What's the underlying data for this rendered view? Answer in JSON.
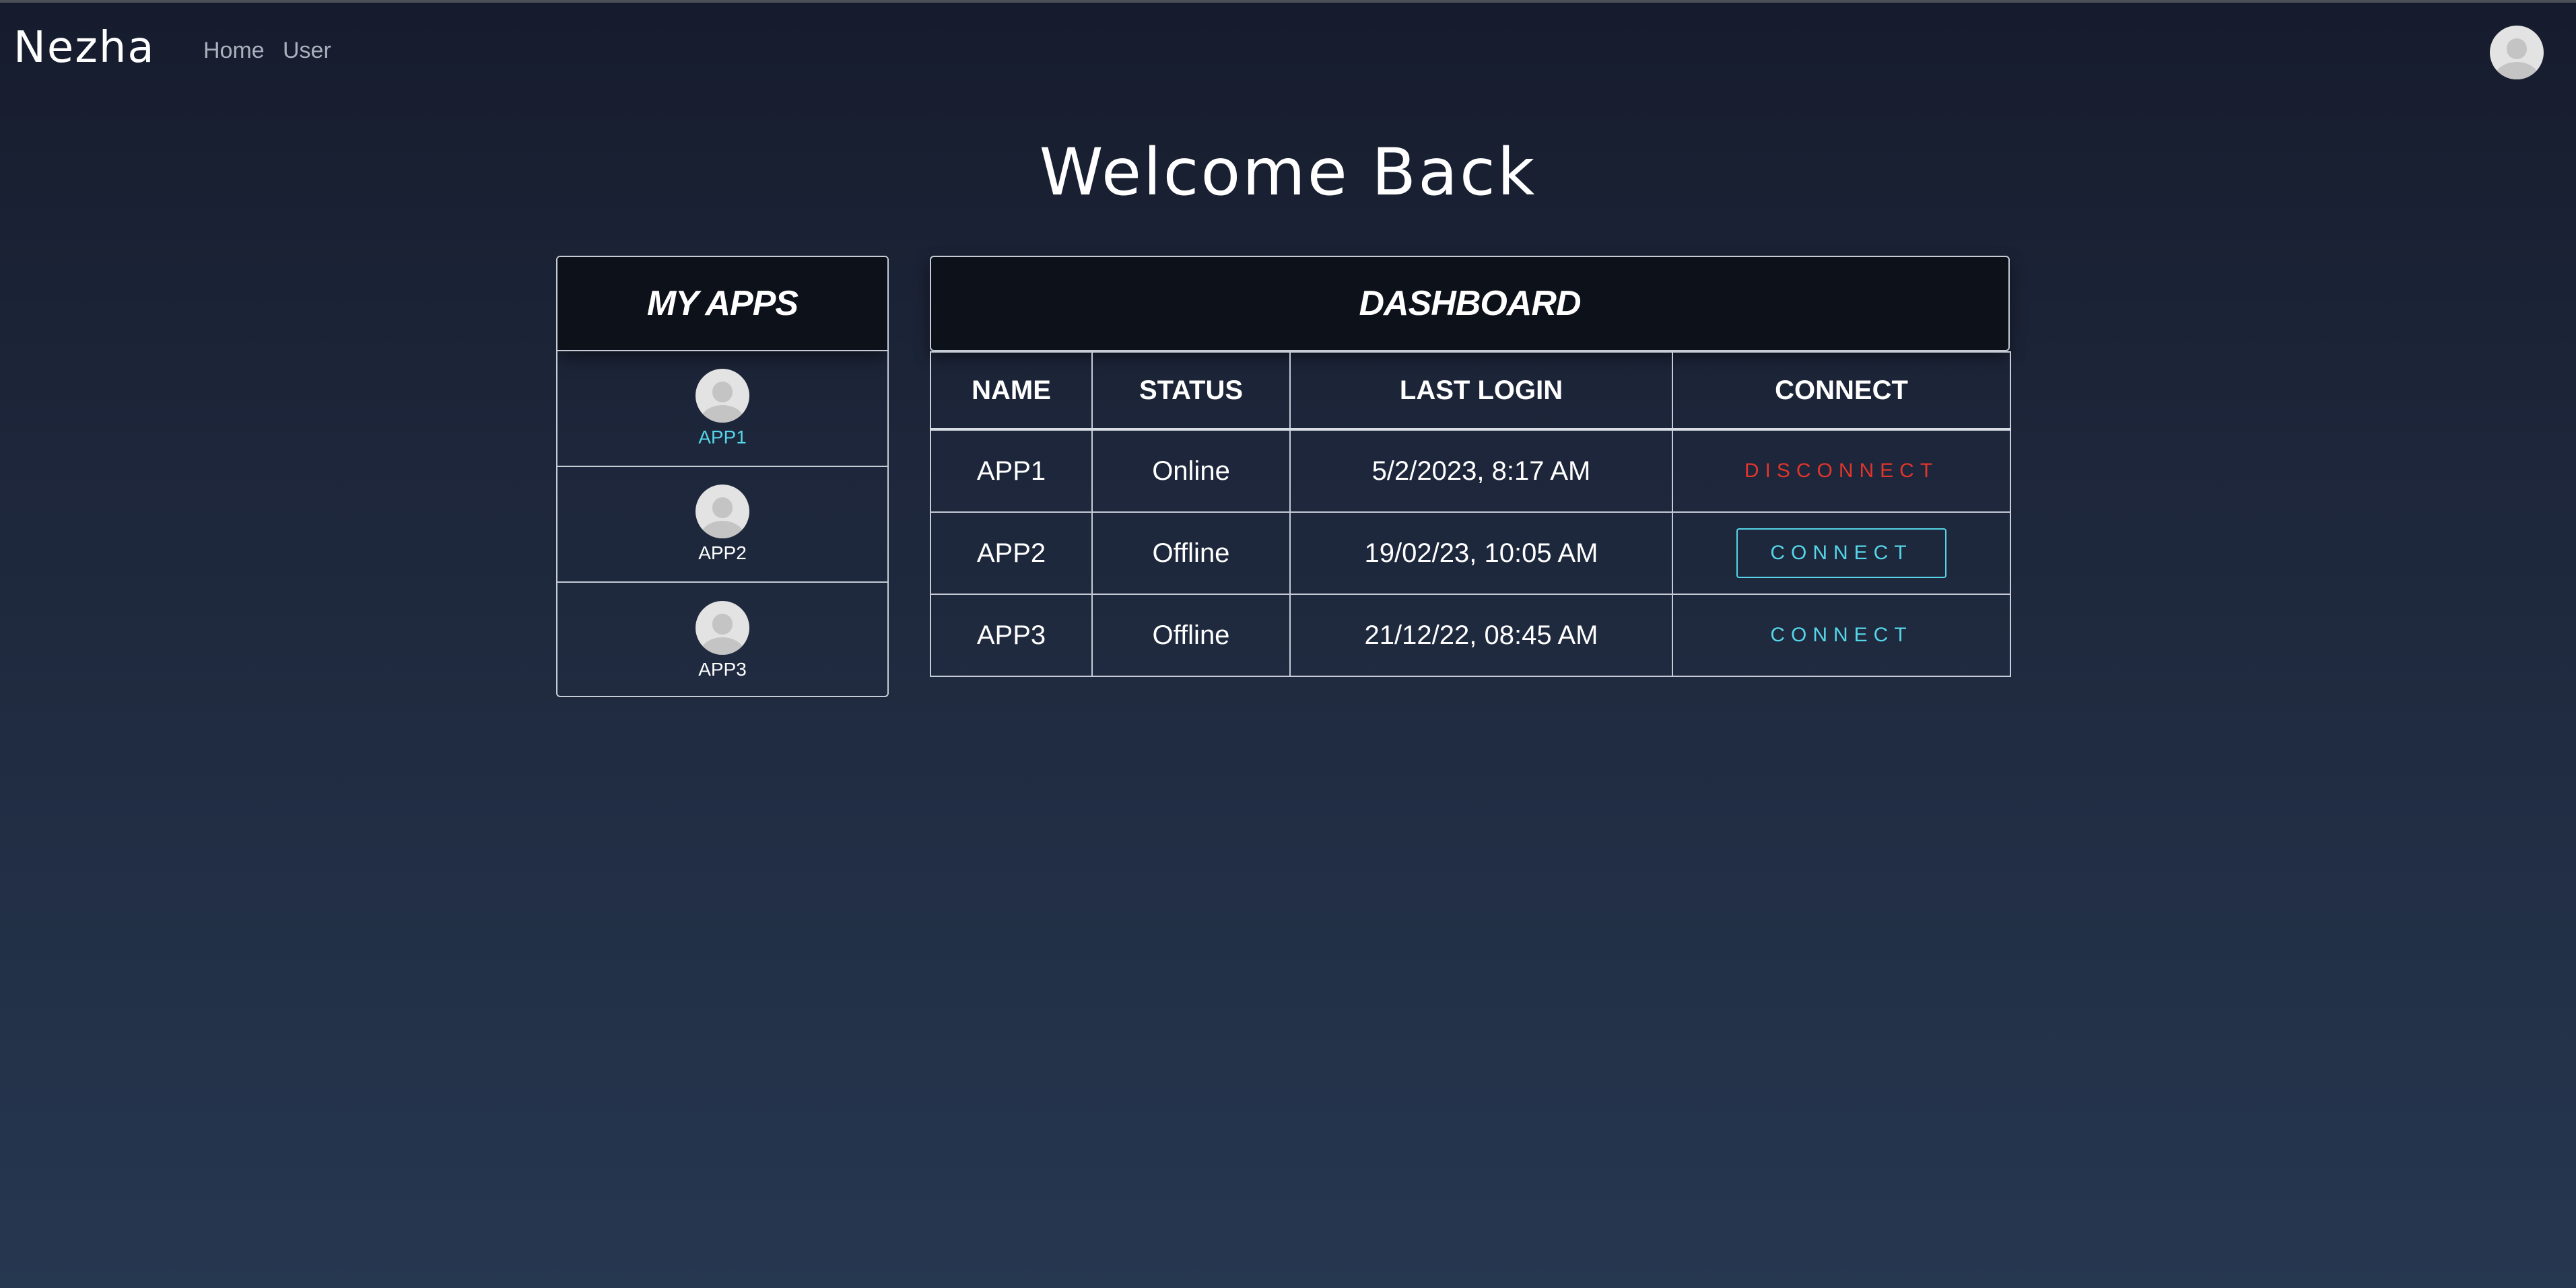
{
  "navbar": {
    "brand": "Nezha",
    "links": [
      "Home",
      "User"
    ]
  },
  "page_title": "Welcome Back",
  "apps_panel": {
    "title": "MY APPS",
    "apps": [
      {
        "label": "APP1",
        "active": true
      },
      {
        "label": "APP2",
        "active": false
      },
      {
        "label": "APP3",
        "active": false
      }
    ]
  },
  "dashboard": {
    "title": "DASHBOARD",
    "columns": [
      "NAME",
      "STATUS",
      "LAST LOGIN",
      "CONNECT"
    ],
    "rows": [
      {
        "name": "APP1",
        "status": "Online",
        "last_login": "5/2/2023, 8:17 AM",
        "action": "DISCONNECT"
      },
      {
        "name": "APP2",
        "status": "Offline",
        "last_login": "19/02/23, 10:05 AM",
        "action": "CONNECT"
      },
      {
        "name": "APP3",
        "status": "Offline",
        "last_login": "21/12/22, 08:45 AM",
        "action": "CONNECT"
      }
    ]
  },
  "colors": {
    "accent_cyan": "#56d6e8",
    "disconnect_red": "#e2352c",
    "panel_header_bg": "#0d111a",
    "border": "#c6ccd6"
  },
  "icons": {
    "user_avatar": "user-avatar-icon",
    "app_avatar": "app-avatar-icon"
  }
}
